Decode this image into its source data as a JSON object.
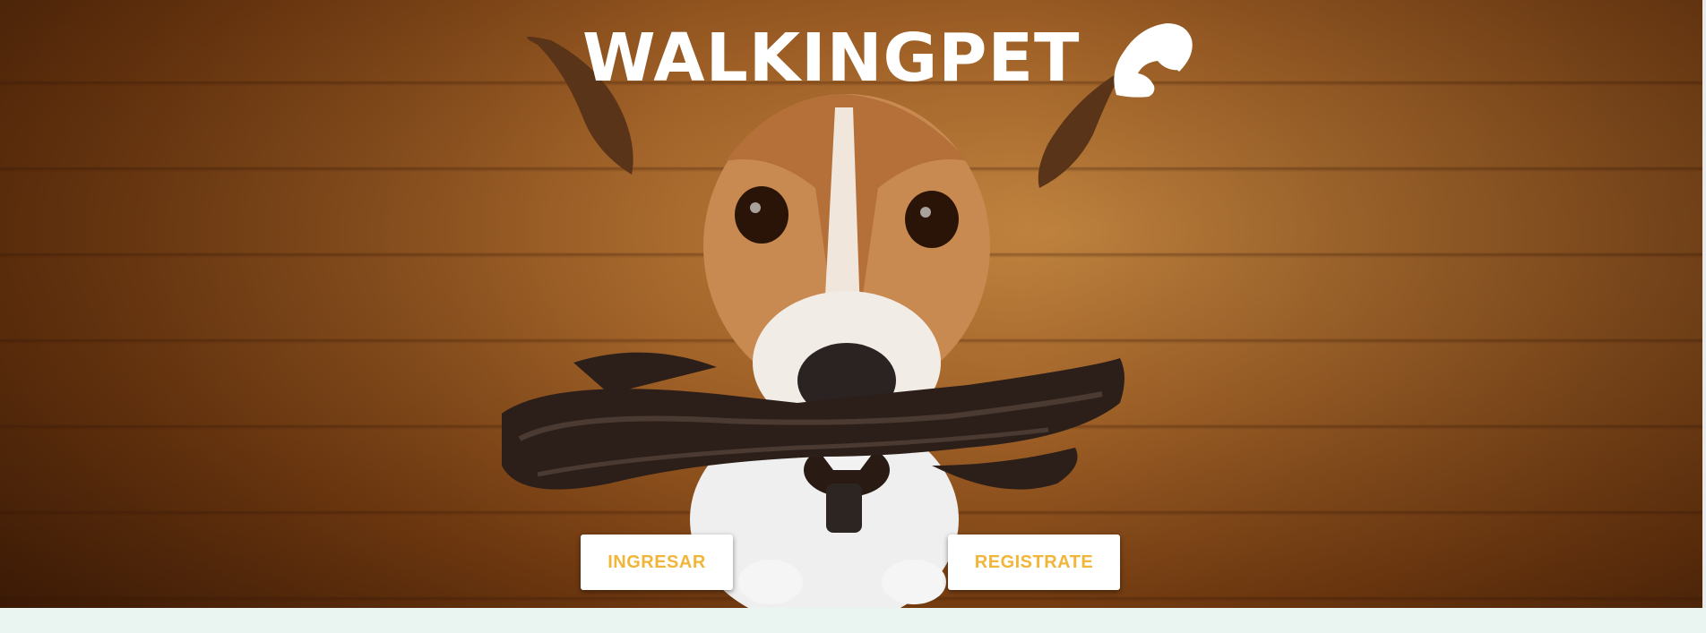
{
  "brand": {
    "name": "WALKINGPET",
    "logo_icon": "bird-head-icon"
  },
  "hero": {
    "image_subject": "dog-with-leash",
    "background_color": "#a8672a"
  },
  "actions": {
    "login_label": "INGRESAR",
    "register_label": "REGISTRATE",
    "label_color": "#f1b53a"
  },
  "footer": {
    "background_color": "#eaf4f1"
  }
}
